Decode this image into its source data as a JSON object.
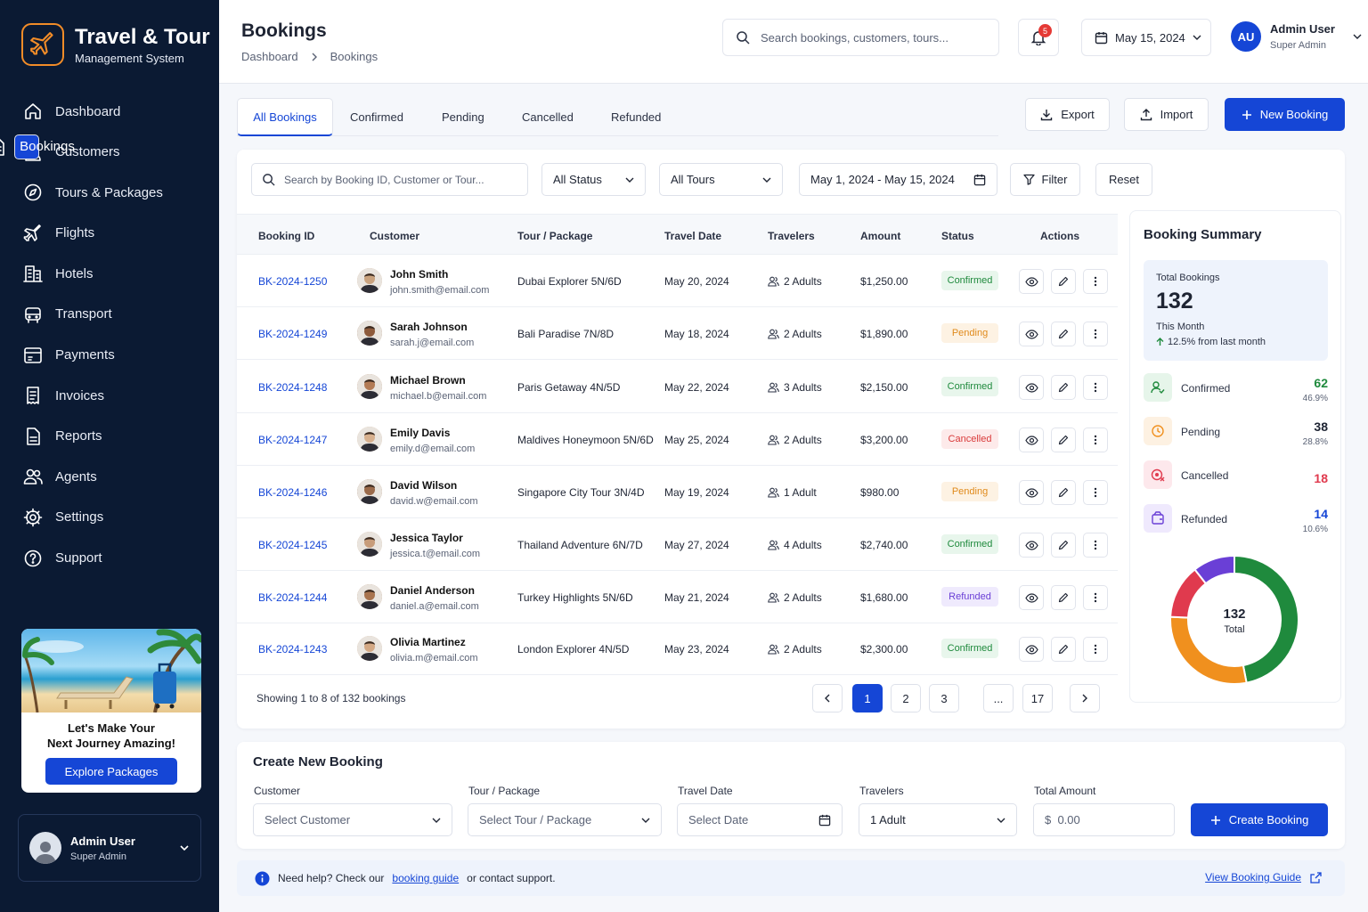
{
  "brand": {
    "title": "Travel & Tour",
    "subtitle": "Management System",
    "accent": "#f28c28"
  },
  "nav": [
    {
      "label": "Dashboard",
      "icon": "home-icon"
    },
    {
      "label": "Bookings",
      "icon": "file-icon",
      "active": true
    },
    {
      "label": "Customers",
      "icon": "user-icon"
    },
    {
      "label": "Tours & Packages",
      "icon": "compass-icon"
    },
    {
      "label": "Flights",
      "icon": "plane-icon"
    },
    {
      "label": "Hotels",
      "icon": "building-icon"
    },
    {
      "label": "Transport",
      "icon": "bus-icon"
    },
    {
      "label": "Payments",
      "icon": "payment-icon"
    },
    {
      "label": "Invoices",
      "icon": "invoice-icon"
    },
    {
      "label": "Reports",
      "icon": "report-icon"
    },
    {
      "label": "Agents",
      "icon": "users-icon"
    },
    {
      "label": "Settings",
      "icon": "gear-icon"
    },
    {
      "label": "Support",
      "icon": "help-icon"
    }
  ],
  "promo": {
    "line1": "Let's Make Your",
    "line2": "Next Journey Amazing!",
    "button": "Explore Packages"
  },
  "sidebar_user": {
    "name": "Admin User",
    "role": "Super Admin"
  },
  "header": {
    "title": "Bookings",
    "breadcrumb": [
      "Dashboard",
      "Bookings"
    ],
    "search_placeholder": "Search bookings, customers, tours...",
    "notifications": "5",
    "date": "May 15, 2024",
    "user": {
      "initials": "AU",
      "name": "Admin User",
      "role": "Super Admin"
    }
  },
  "tabs": [
    "All Bookings",
    "Confirmed",
    "Pending",
    "Cancelled",
    "Refunded"
  ],
  "toolbar": {
    "export": "Export",
    "import": "Import",
    "new": "New Booking"
  },
  "filters": {
    "search_placeholder": "Search by Booking ID, Customer or Tour...",
    "status": "All Status",
    "tours": "All Tours",
    "date_range": "May 1, 2024 - May 15, 2024",
    "filter": "Filter",
    "reset": "Reset"
  },
  "table": {
    "columns": [
      "Booking ID",
      "Customer",
      "Tour / Package",
      "Travel Date",
      "Travelers",
      "Amount",
      "Status",
      "Actions"
    ],
    "rows": [
      {
        "id": "BK-2024-1250",
        "name": "John Smith",
        "email": "john.smith@email.com",
        "tour": "Dubai Explorer 5N/6D",
        "date": "May 20, 2024",
        "travelers": "2 Adults",
        "amount": "$1,250.00",
        "status": "Confirmed"
      },
      {
        "id": "BK-2024-1249",
        "name": "Sarah Johnson",
        "email": "sarah.j@email.com",
        "tour": "Bali Paradise 7N/8D",
        "date": "May 18, 2024",
        "travelers": "2 Adults",
        "amount": "$1,890.00",
        "status": "Pending"
      },
      {
        "id": "BK-2024-1248",
        "name": "Michael Brown",
        "email": "michael.b@email.com",
        "tour": "Paris Getaway 4N/5D",
        "date": "May 22, 2024",
        "travelers": "3 Adults",
        "amount": "$2,150.00",
        "status": "Confirmed"
      },
      {
        "id": "BK-2024-1247",
        "name": "Emily Davis",
        "email": "emily.d@email.com",
        "tour": "Maldives Honeymoon 5N/6D",
        "date": "May 25, 2024",
        "travelers": "2 Adults",
        "amount": "$3,200.00",
        "status": "Cancelled"
      },
      {
        "id": "BK-2024-1246",
        "name": "David Wilson",
        "email": "david.w@email.com",
        "tour": "Singapore City Tour 3N/4D",
        "date": "May 19, 2024",
        "travelers": "1 Adult",
        "amount": "$980.00",
        "status": "Pending"
      },
      {
        "id": "BK-2024-1245",
        "name": "Jessica Taylor",
        "email": "jessica.t@email.com",
        "tour": "Thailand Adventure 6N/7D",
        "date": "May 27, 2024",
        "travelers": "4 Adults",
        "amount": "$2,740.00",
        "status": "Confirmed"
      },
      {
        "id": "BK-2024-1244",
        "name": "Daniel Anderson",
        "email": "daniel.a@email.com",
        "tour": "Turkey Highlights 5N/6D",
        "date": "May 21, 2024",
        "travelers": "2 Adults",
        "amount": "$1,680.00",
        "status": "Refunded"
      },
      {
        "id": "BK-2024-1243",
        "name": "Olivia Martinez",
        "email": "olivia.m@email.com",
        "tour": "London Explorer 4N/5D",
        "date": "May 23, 2024",
        "travelers": "2 Adults",
        "amount": "$2,300.00",
        "status": "Confirmed"
      }
    ]
  },
  "pagination": {
    "showing": "Showing 1 to 8 of 132 bookings",
    "pages": [
      "1",
      "2",
      "3",
      "...",
      "17"
    ],
    "current": "1"
  },
  "summary": {
    "title": "Booking Summary",
    "total_label": "Total Bookings",
    "total": "132",
    "month_label": "This Month",
    "month_change": "12.5% from last month",
    "items": [
      {
        "label": "Confirmed",
        "value": "62",
        "pct": "46.9%",
        "color": "#1f8a3d",
        "count": 62
      },
      {
        "label": "Pending",
        "value": "38",
        "pct": "28.8%",
        "color": "#f0901e",
        "count": 38
      },
      {
        "label": "Cancelled",
        "value": "18",
        "pct": "",
        "color": "#e03a4e",
        "count": 18
      },
      {
        "label": "Refunded",
        "value": "14",
        "pct": "10.6%",
        "color": "#6a3fd6",
        "count": 14
      }
    ],
    "donut_value": "132",
    "donut_label": "Total"
  },
  "create": {
    "title": "Create New Booking",
    "customer_label": "Customer",
    "customer_ph": "Select Customer",
    "tour_label": "Tour / Package",
    "tour_ph": "Select Tour / Package",
    "date_label": "Travel Date",
    "date_ph": "Select Date",
    "travelers_label": "Travelers",
    "travelers_val": "1 Adult",
    "amount_label": "Total Amount",
    "amount_val": "$  0.00",
    "button": "Create Booking"
  },
  "help": {
    "pre": "Need help? Check our",
    "link": "booking guide",
    "post": "or contact support.",
    "guide": "View Booking Guide"
  }
}
